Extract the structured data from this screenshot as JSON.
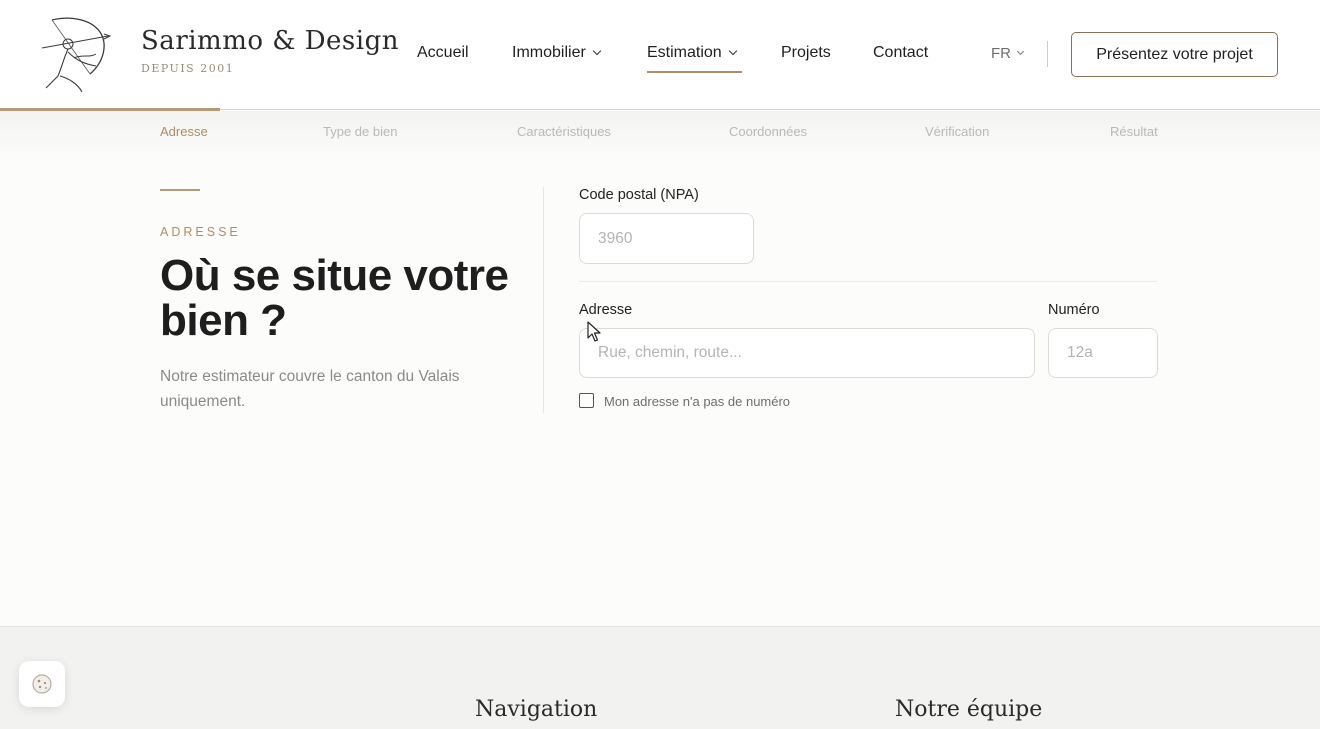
{
  "brand": {
    "name": "Sarimmo & Design",
    "since": "DEPUIS 2001"
  },
  "nav": {
    "items": [
      {
        "label": "Accueil",
        "has_dropdown": false,
        "active": false
      },
      {
        "label": "Immobilier",
        "has_dropdown": true,
        "active": false
      },
      {
        "label": "Estimation",
        "has_dropdown": true,
        "active": true
      },
      {
        "label": "Projets",
        "has_dropdown": false,
        "active": false
      },
      {
        "label": "Contact",
        "has_dropdown": false,
        "active": false
      }
    ],
    "language": "FR",
    "cta_label": "Présentez votre projet"
  },
  "wizard": {
    "progress": 0.167,
    "steps": [
      {
        "label": "Adresse",
        "active": true
      },
      {
        "label": "Type de bien",
        "active": false
      },
      {
        "label": "Caractéristiques",
        "active": false
      },
      {
        "label": "Coordonnées",
        "active": false
      },
      {
        "label": "Vérification",
        "active": false
      },
      {
        "label": "Résultat",
        "active": false
      }
    ]
  },
  "intro": {
    "eyebrow": "ADRESSE",
    "headline": "Où se situe votre bien ?",
    "lead": "Notre estimateur couvre le canton du Valais uniquement."
  },
  "form": {
    "postal_label": "Code postal (NPA)",
    "postal_placeholder": "3960",
    "address_label": "Adresse",
    "address_placeholder": "Rue, chemin, route...",
    "number_label": "Numéro",
    "number_placeholder": "12a",
    "no_number_label": "Mon adresse n'a pas de numéro",
    "no_number_checked": false
  },
  "footer": {
    "navigation_heading": "Navigation",
    "team_heading": "Notre équipe"
  },
  "colors": {
    "accent": "#b08d62",
    "text": "#1e1e1e",
    "muted": "#8a8a8a"
  },
  "icons": {
    "logo": "archer-logo-icon",
    "cookie": "cookie-icon",
    "cursor": "mouse-pointer-icon"
  }
}
